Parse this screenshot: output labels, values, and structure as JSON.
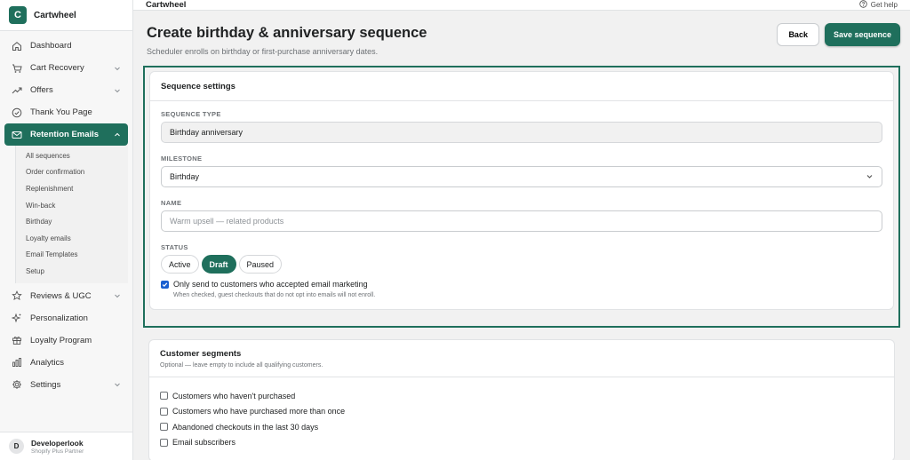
{
  "brand": {
    "logo_letter": "C",
    "name": "Cartwheel"
  },
  "colors": {
    "accent": "#1f6f5c",
    "checkbox": "#1a5fd0"
  },
  "sidebar": {
    "items": [
      {
        "label": "Dashboard",
        "icon": "home-icon"
      },
      {
        "label": "Cart Recovery",
        "icon": "cart-icon"
      },
      {
        "label": "Offers",
        "icon": "trend-icon"
      },
      {
        "label": "Thank You Page",
        "icon": "check-circle-icon"
      },
      {
        "label": "Retention Emails",
        "icon": "mail-icon"
      },
      {
        "label": "Reviews & UGC",
        "icon": "star-icon"
      },
      {
        "label": "Personalization",
        "icon": "sparkle-icon"
      },
      {
        "label": "Loyalty Program",
        "icon": "gift-icon"
      },
      {
        "label": "Analytics",
        "icon": "bar-chart-icon"
      },
      {
        "label": "Settings",
        "icon": "gear-icon"
      }
    ],
    "sub_items": [
      "All sequences",
      "Order confirmation",
      "Replenishment",
      "Win-back",
      "Birthday",
      "Loyalty emails",
      "Email Templates",
      "Setup"
    ],
    "account": {
      "initial": "D",
      "name": "Developerlook",
      "plan": "Shopify Plus Partner"
    }
  },
  "topbar": {
    "title": "Cartwheel",
    "help": "Get help"
  },
  "page": {
    "title": "Create birthday & anniversary sequence",
    "subtitle": "Scheduler enrolls on birthday or first-purchase anniversary dates.",
    "back": "Back",
    "save": "Save sequence"
  },
  "settings": {
    "title": "Sequence settings",
    "type_label": "SEQUENCE TYPE",
    "type_value": "Birthday anniversary",
    "milestone_label": "MILESTONE",
    "milestone_value": "Birthday",
    "name_label": "NAME",
    "name_placeholder": "Warm upsell — related products",
    "status_label": "STATUS",
    "status_options": [
      "Active",
      "Draft",
      "Paused"
    ],
    "status_selected": "Draft",
    "consent_label": "Only send to customers who accepted email marketing",
    "consent_checked": true,
    "consent_help": "When checked, guest checkouts that do not opt into emails will not enroll."
  },
  "segments": {
    "title": "Customer segments",
    "subtitle": "Optional — leave empty to include all qualifying customers.",
    "items": [
      "Customers who haven't purchased",
      "Customers who have purchased more than once",
      "Abandoned checkouts in the last 30 days",
      "Email subscribers"
    ]
  }
}
